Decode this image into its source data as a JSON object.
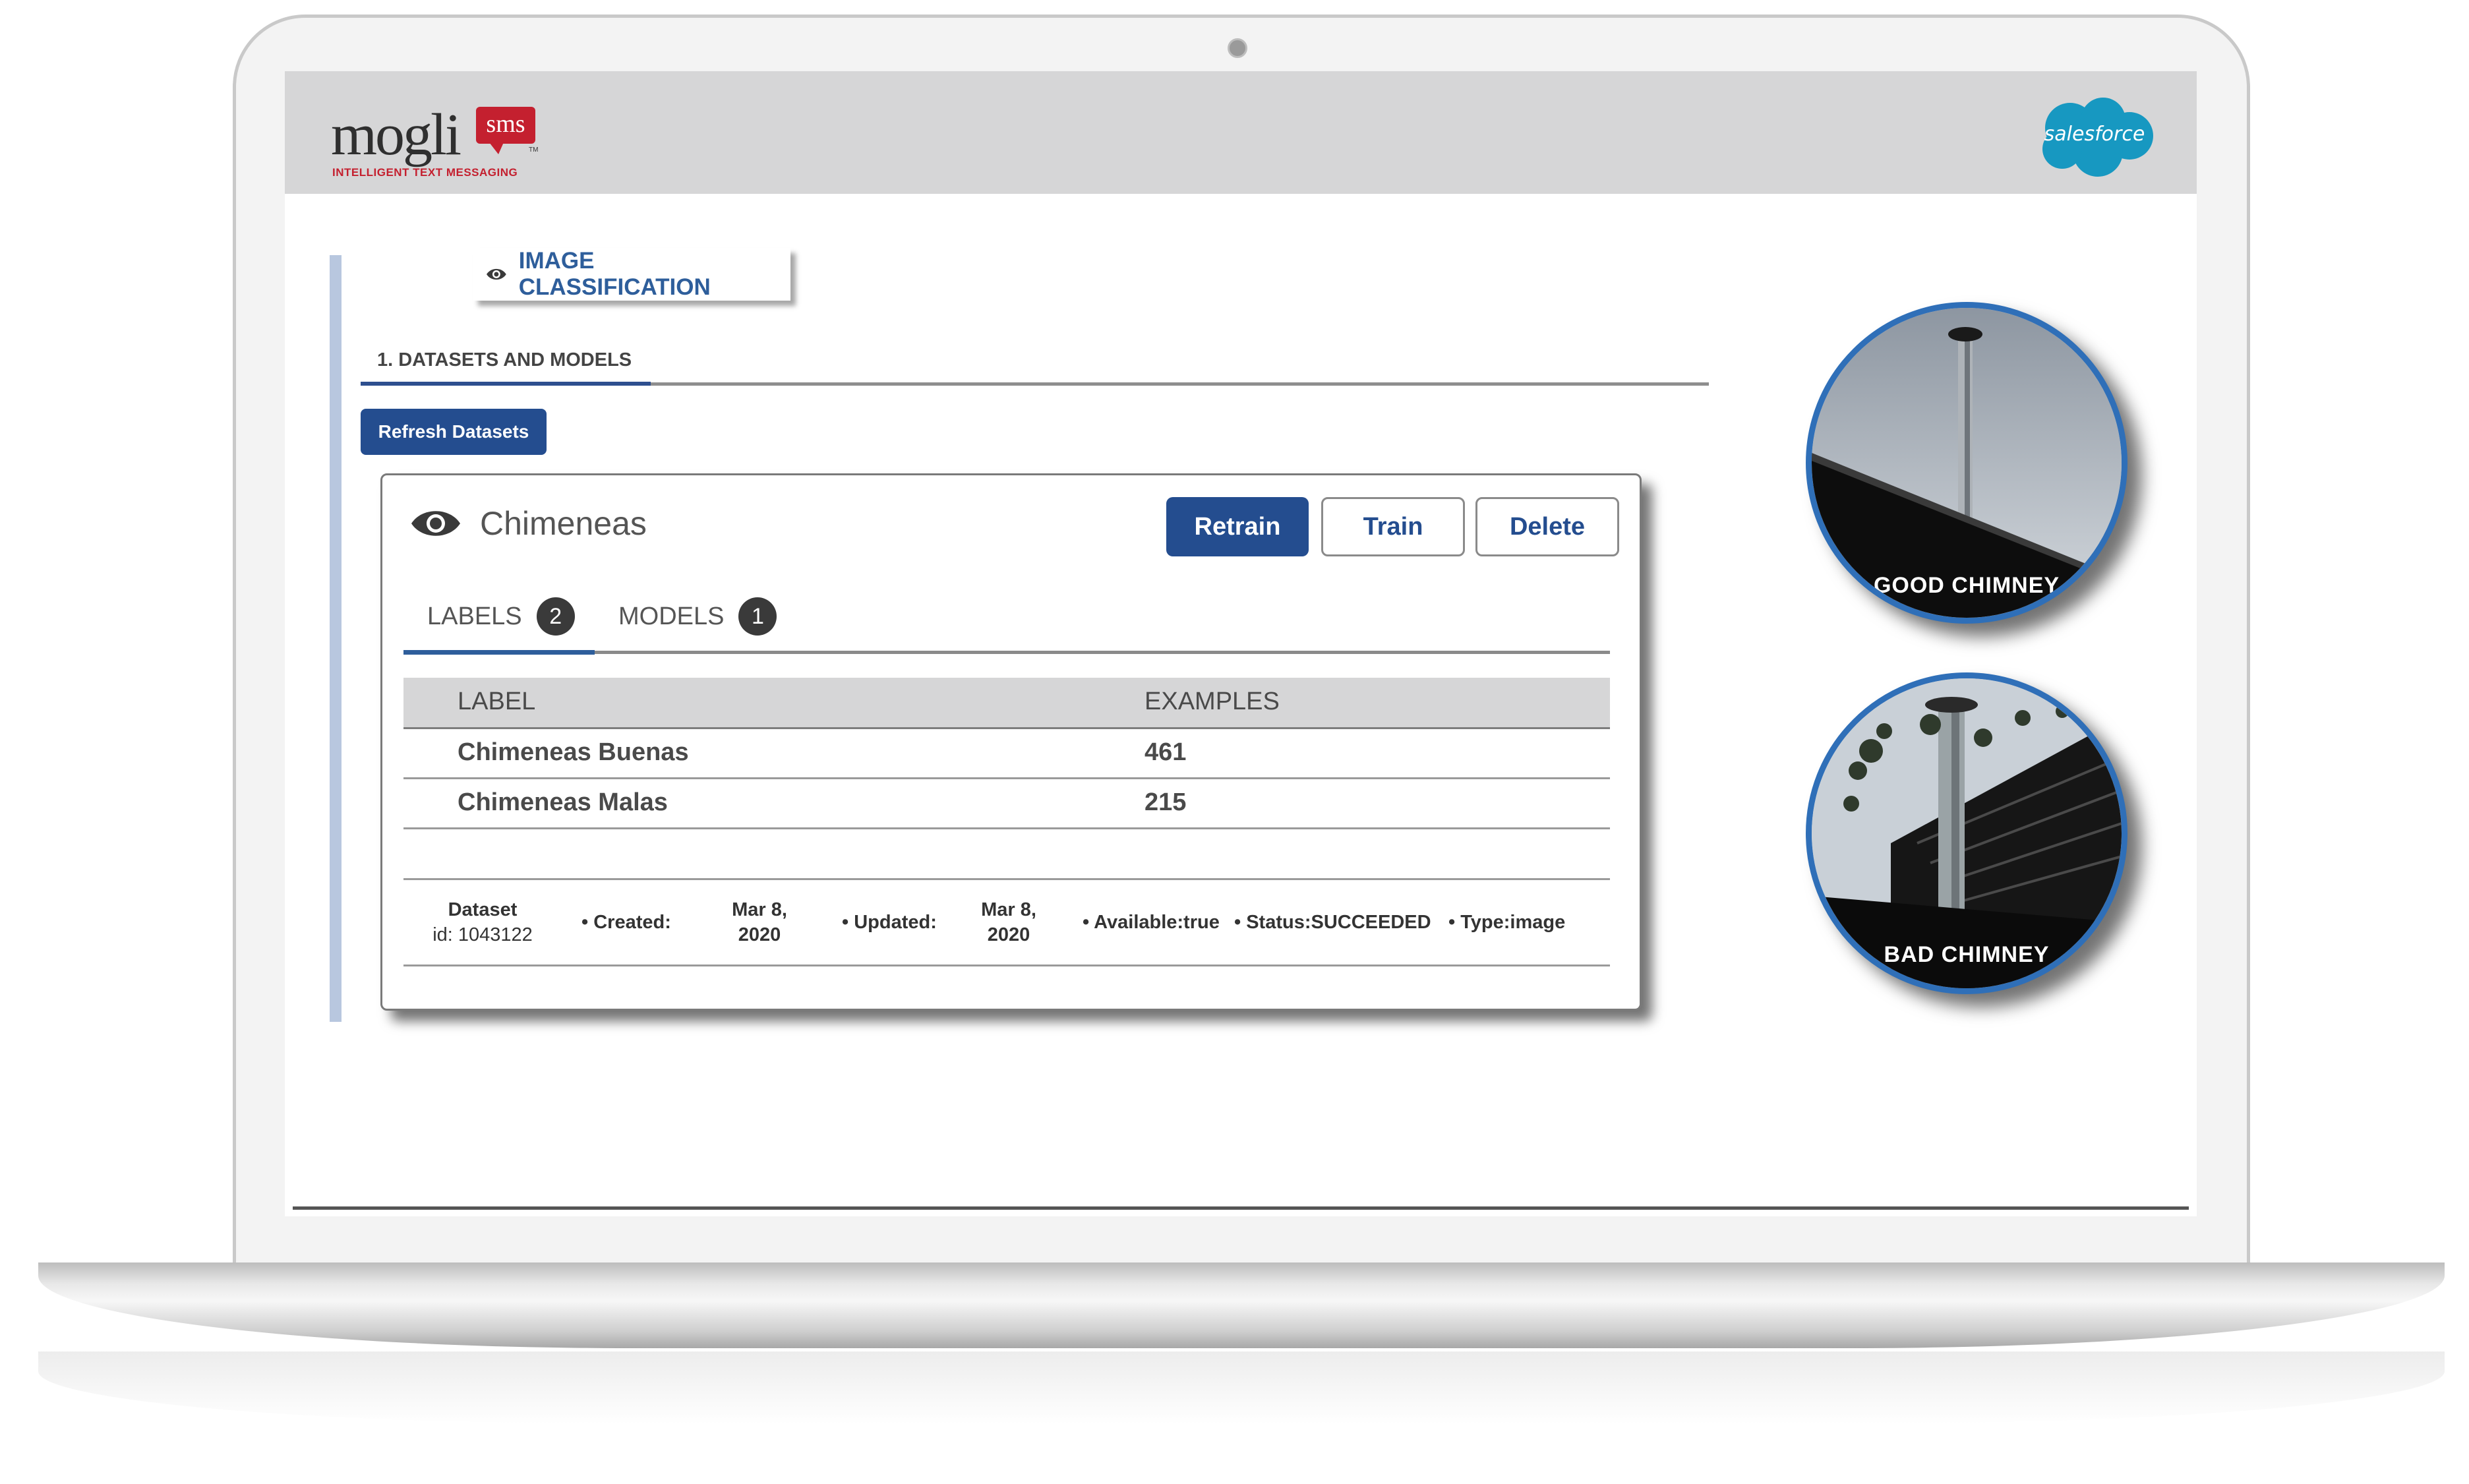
{
  "brand": {
    "logo_word": "mogli",
    "logo_badge": "sms",
    "logo_tm": "TM",
    "logo_tagline": "INTELLIGENT TEXT MESSAGING",
    "partner": "salesforce"
  },
  "section_tab": {
    "label": "IMAGE CLASSIFICATION",
    "icon": "eye-icon"
  },
  "datasets_section": {
    "title": "1. DATASETS AND MODELS",
    "refresh_button": "Refresh Datasets"
  },
  "dataset_card": {
    "name": "Chimeneas",
    "icon": "eye-icon",
    "buttons": {
      "retrain": "Retrain",
      "train": "Train",
      "delete": "Delete"
    },
    "tabs": [
      {
        "label": "LABELS",
        "count": "2"
      },
      {
        "label": "MODELS",
        "count": "1"
      }
    ],
    "table": {
      "headers": [
        "LABEL",
        "EXAMPLES"
      ],
      "rows": [
        {
          "label": "Chimeneas Buenas",
          "examples": "461"
        },
        {
          "label": "Chimeneas Malas",
          "examples": "215"
        }
      ]
    },
    "meta": {
      "dataset": "Dataset",
      "dataset_id": "id: 1043122",
      "created_label": "• Created:",
      "created_value_1": "Mar 8,",
      "created_value_2": "2020",
      "updated_label": "• Updated:",
      "updated_value_1": "Mar 8,",
      "updated_value_2": "2020",
      "available": "• Available:true",
      "status": "• Status:SUCCEEDED",
      "type": "• Type:image"
    }
  },
  "photos": [
    {
      "caption": "GOOD  CHIMNEY"
    },
    {
      "caption": "BAD CHIMNEY"
    }
  ],
  "colors": {
    "accent": "#244d8f",
    "accent_text": "#2e5e9b",
    "header_bg": "#d6d6d7",
    "brand_red": "#c4202f",
    "photo_ring": "#2f6fb8"
  }
}
